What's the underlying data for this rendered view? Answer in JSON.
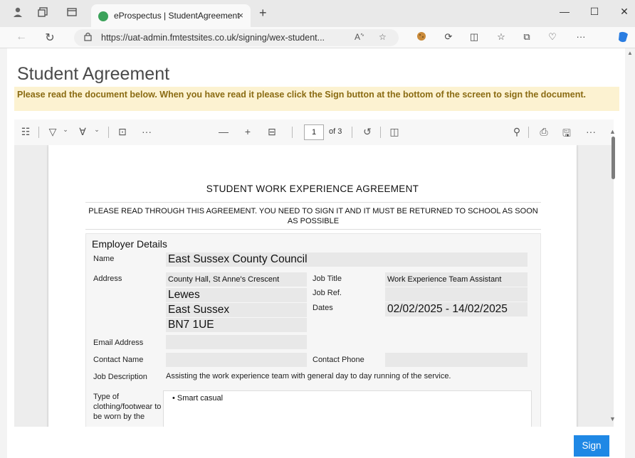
{
  "browser": {
    "tab_title": "eProspectus | StudentAgreement",
    "tab_close": "×",
    "new_tab": "+",
    "url": "https://uat-admin.fmtestsites.co.uk/signing/wex-student...",
    "win_minimize": "—",
    "win_maximize": "☐",
    "win_close": "✕",
    "read_aloud": "A&#8413;",
    "more": "···"
  },
  "page": {
    "title": "Student Agreement",
    "notice": "Please read the document below. When you have read it please click the Sign button at the bottom of the screen to sign the document."
  },
  "pdf_toolbar": {
    "page_number": "1",
    "page_of": "of 3",
    "more": "···",
    "zoom_out": "—",
    "zoom_in": "+",
    "more_right": "···"
  },
  "document": {
    "title": "STUDENT WORK EXPERIENCE AGREEMENT",
    "subtitle": "PLEASE READ THROUGH THIS AGREEMENT. YOU NEED TO SIGN IT AND IT MUST BE RETURNED TO SCHOOL AS SOON AS POSSIBLE",
    "section_heading": "Employer Details",
    "labels": {
      "name": "Name",
      "address": "Address",
      "job_title": "Job Title",
      "job_ref": "Job Ref.",
      "dates": "Dates",
      "email": "Email Address",
      "contact_name": "Contact Name",
      "contact_phone": "Contact Phone",
      "job_description": "Job Description",
      "clothing": "Type of clothing/footwear to be worn by the"
    },
    "values": {
      "name": "East Sussex County Council",
      "address_line1": "County Hall, St Anne's Crescent",
      "address_line2": "Lewes",
      "address_line3": "East Sussex",
      "address_line4": "BN7 1UE",
      "job_title": "Work Experience Team Assistant",
      "job_ref": "",
      "dates": "02/02/2025 - 14/02/2025",
      "email": "",
      "contact_name": "",
      "contact_phone": "",
      "job_description": "Assisting the work experience team with general day to day running of the service.",
      "clothing_item": "• Smart casual"
    }
  },
  "sign_button": "Sign"
}
